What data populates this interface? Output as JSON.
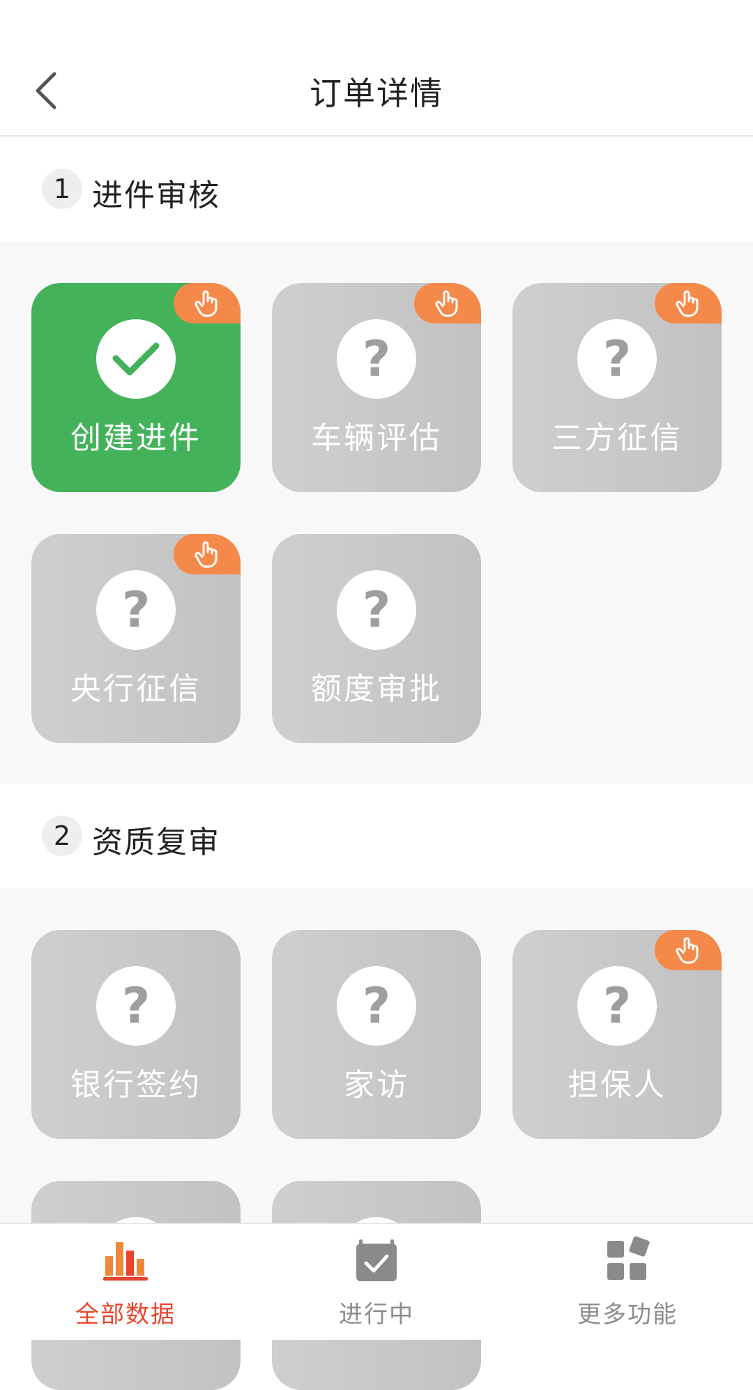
{
  "header": {
    "title": "订单详情"
  },
  "sections": [
    {
      "number": "1",
      "title": "进件审核",
      "cards": [
        {
          "label": "创建进件",
          "status": "done",
          "badge": true
        },
        {
          "label": "车辆评估",
          "status": "unknown",
          "badge": true
        },
        {
          "label": "三方征信",
          "status": "unknown",
          "badge": true
        },
        {
          "label": "央行征信",
          "status": "unknown",
          "badge": true
        },
        {
          "label": "额度审批",
          "status": "unknown",
          "badge": false
        }
      ]
    },
    {
      "number": "2",
      "title": "资质复审",
      "cards": [
        {
          "label": "银行签约",
          "status": "unknown",
          "badge": false
        },
        {
          "label": "家访",
          "status": "unknown",
          "badge": false
        },
        {
          "label": "担保人",
          "status": "unknown",
          "badge": true
        },
        {
          "label": "",
          "status": "unknown",
          "badge": false
        },
        {
          "label": "",
          "status": "unknown",
          "badge": false
        }
      ]
    }
  ],
  "card_question_mark": "?",
  "tabbar": {
    "items": [
      {
        "label": "全部数据",
        "icon": "bar-chart-icon",
        "active": true
      },
      {
        "label": "进行中",
        "icon": "calendar-check-icon",
        "active": false
      },
      {
        "label": "更多功能",
        "icon": "apps-grid-icon",
        "active": false
      }
    ]
  },
  "colors": {
    "accent": "#e8452c",
    "done_green": "#43b25b",
    "badge_orange": "#f5894a",
    "card_gray": "#c8c8c8"
  }
}
